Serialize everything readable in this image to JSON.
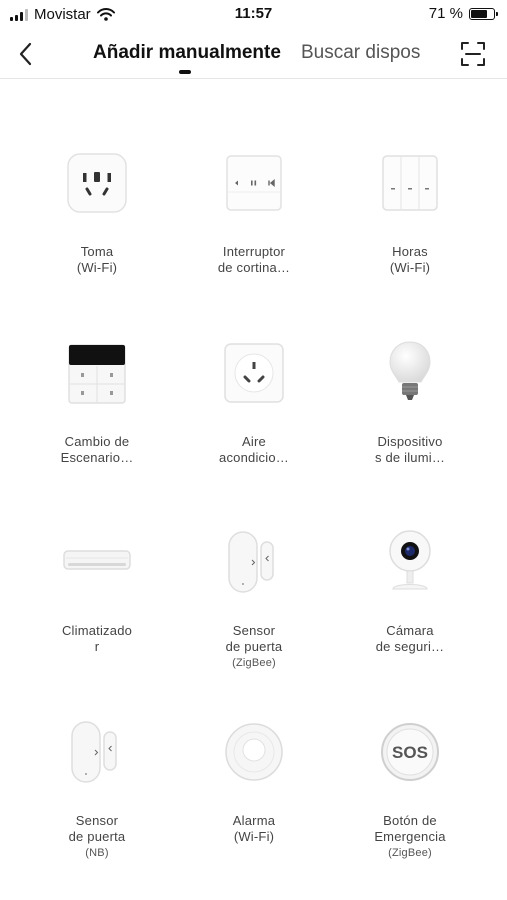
{
  "status_bar": {
    "carrier": "Movistar",
    "time": "11:57",
    "battery": "71 %",
    "battery_level": 0.71
  },
  "nav": {
    "tabs": [
      {
        "label": "Añadir manualmente",
        "active": true
      },
      {
        "label": "Buscar dispos",
        "active": false
      }
    ]
  },
  "devices": [
    {
      "line1": "Toma",
      "line2": "(Wi-Fi)",
      "sub": "",
      "icon": "socket-icon"
    },
    {
      "line1": "Interruptor",
      "line2": "de cortina…",
      "sub": "",
      "icon": "curtain-switch-icon"
    },
    {
      "line1": "Horas",
      "line2": "(Wi-Fi)",
      "sub": "",
      "icon": "triple-switch-icon"
    },
    {
      "line1": "Cambio de",
      "line2": "Escenario…",
      "sub": "",
      "icon": "scene-switch-icon"
    },
    {
      "line1": "Aire",
      "line2": "acondicio…",
      "sub": "",
      "icon": "ac-socket-icon"
    },
    {
      "line1": "Dispositivo",
      "line2": "s de ilumi…",
      "sub": "",
      "icon": "light-bulb-icon"
    },
    {
      "line1": "Climatizado",
      "line2": "r",
      "sub": "",
      "icon": "air-conditioner-icon"
    },
    {
      "line1": "Sensor",
      "line2": "de puerta",
      "sub": "(ZigBee)",
      "icon": "door-sensor-icon"
    },
    {
      "line1": "Cámara",
      "line2": "de seguri…",
      "sub": "",
      "icon": "security-camera-icon"
    },
    {
      "line1": "Sensor",
      "line2": "de puerta",
      "sub": "(NB)",
      "icon": "door-sensor-icon"
    },
    {
      "line1": "Alarma",
      "line2": "(Wi-Fi)",
      "sub": "",
      "icon": "smoke-alarm-icon"
    },
    {
      "line1": "Botón de",
      "line2": "Emergencia",
      "sub": "(ZigBee)",
      "icon": "sos-button-icon"
    }
  ],
  "sos_text": "SOS"
}
